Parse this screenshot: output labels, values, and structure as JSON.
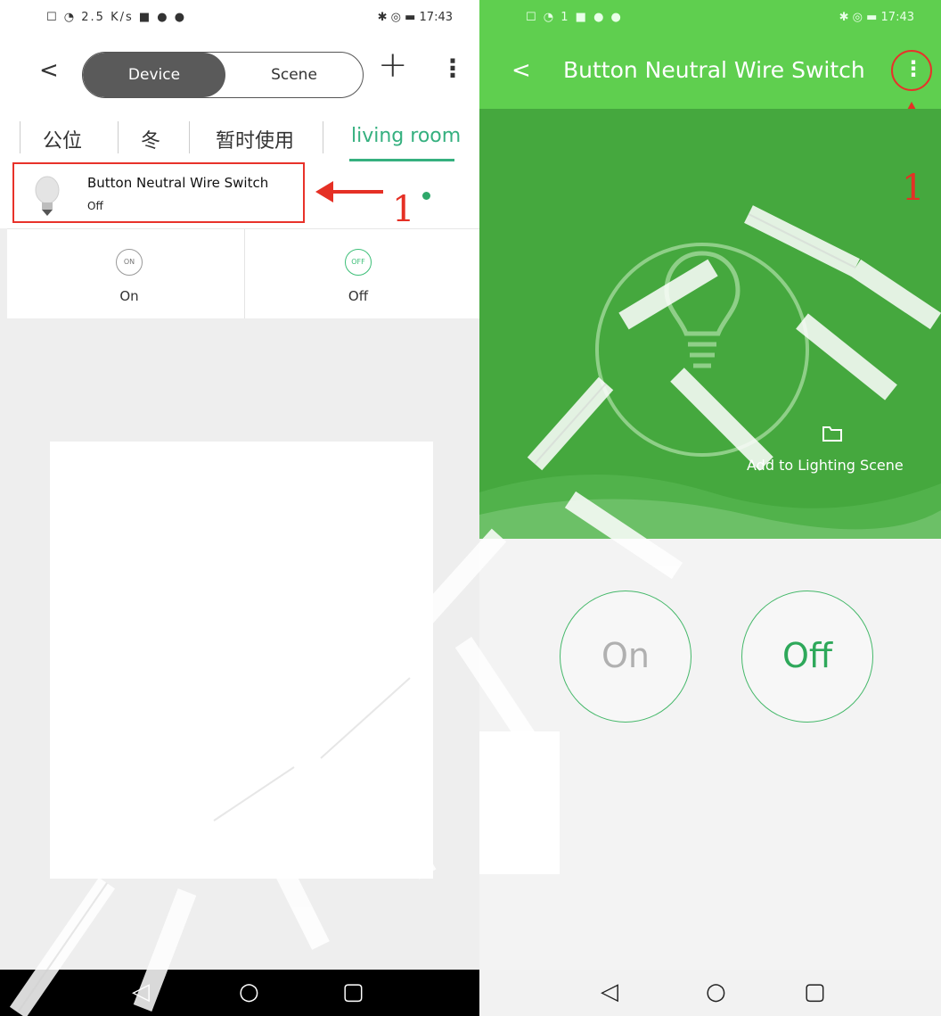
{
  "left": {
    "status": {
      "icons": "☐ ◔ 2.5 K/s ■ ● ●",
      "right": "✱ ◎ ▬ 17:43"
    },
    "header": {
      "back": "<",
      "tab_device": "Device",
      "tab_scene": "Scene",
      "add": "+",
      "more": "⋮"
    },
    "rooms": [
      "公位",
      "冬",
      "暂时使用",
      "living room"
    ],
    "device": {
      "name": "Button Neutral Wire Switch",
      "status": "Off"
    },
    "annotation": {
      "number": "1"
    },
    "actions": {
      "on_icon": "ON",
      "on_label": "On",
      "off_icon": "OFF",
      "off_label": "Off"
    },
    "nav": {
      "back": "◁",
      "home": "○",
      "recent": "▢"
    }
  },
  "right": {
    "status": {
      "icons": "☐ ◔ 1 ■ ● ●",
      "right": "✱ ◎ ▬ 17:43"
    },
    "header": {
      "back": "<",
      "title": "Button Neutral Wire Switch",
      "more": "⋮"
    },
    "annotation": {
      "number": "1"
    },
    "hero": {
      "add_scene": "Add to Lighting Scene"
    },
    "buttons": {
      "on": "On",
      "off": "Off"
    },
    "nav": {
      "back": "◁",
      "home": "○",
      "recent": "▢"
    }
  },
  "colors": {
    "brand_green": "#5fcf4f",
    "hero_green": "#45a83e",
    "accent_teal": "#35b07f",
    "annotation_red": "#e8322a"
  },
  "icons": [
    "back-icon",
    "plus-icon",
    "more-icon",
    "bulb-icon",
    "folder-icon",
    "nav-back-icon",
    "nav-home-icon",
    "nav-recent-icon"
  ]
}
